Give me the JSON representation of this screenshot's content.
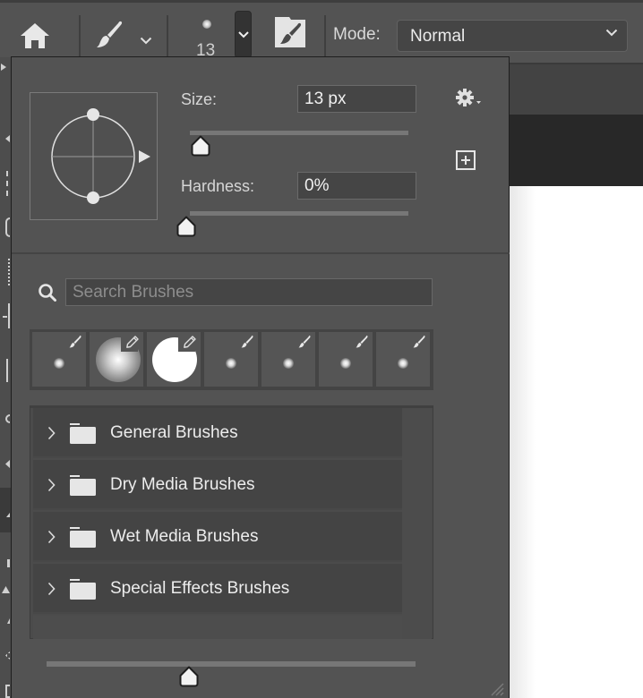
{
  "options_bar": {
    "home_icon": "home-icon",
    "tool_icon": "brush-icon",
    "tool_menu_icon": "chevron-down-icon",
    "brush_size_value": "13",
    "brush_preset_dropdown_icon": "chevron-down-icon",
    "brush_settings_panel_icon": "brush-folder-icon",
    "mode_label": "Mode:",
    "mode_value": "Normal"
  },
  "brush_popup": {
    "size": {
      "label": "Size:",
      "value": "13 px",
      "slider_fraction": 0.05
    },
    "hardness": {
      "label": "Hardness:",
      "value": "0%",
      "slider_fraction": 0.0
    },
    "gear_icon": "gear-icon",
    "new_preset_icon": "plus-square-icon",
    "search": {
      "icon": "search-icon",
      "placeholder": "Search Brushes",
      "value": ""
    },
    "recent_brushes": [
      {
        "type": "small-soft",
        "badge": "brush-icon"
      },
      {
        "type": "large-soft",
        "badge": "pencil-icon"
      },
      {
        "type": "large-hard",
        "badge": "pencil-icon"
      },
      {
        "type": "small-soft",
        "badge": "brush-icon"
      },
      {
        "type": "small-soft",
        "badge": "brush-icon"
      },
      {
        "type": "small-soft",
        "badge": "brush-icon"
      },
      {
        "type": "small-soft",
        "badge": "brush-icon"
      }
    ],
    "folders": [
      {
        "name": "General Brushes"
      },
      {
        "name": "Dry Media Brushes"
      },
      {
        "name": "Wet Media Brushes"
      },
      {
        "name": "Special Effects Brushes"
      }
    ],
    "preview_size_slider_fraction": 0.38
  }
}
